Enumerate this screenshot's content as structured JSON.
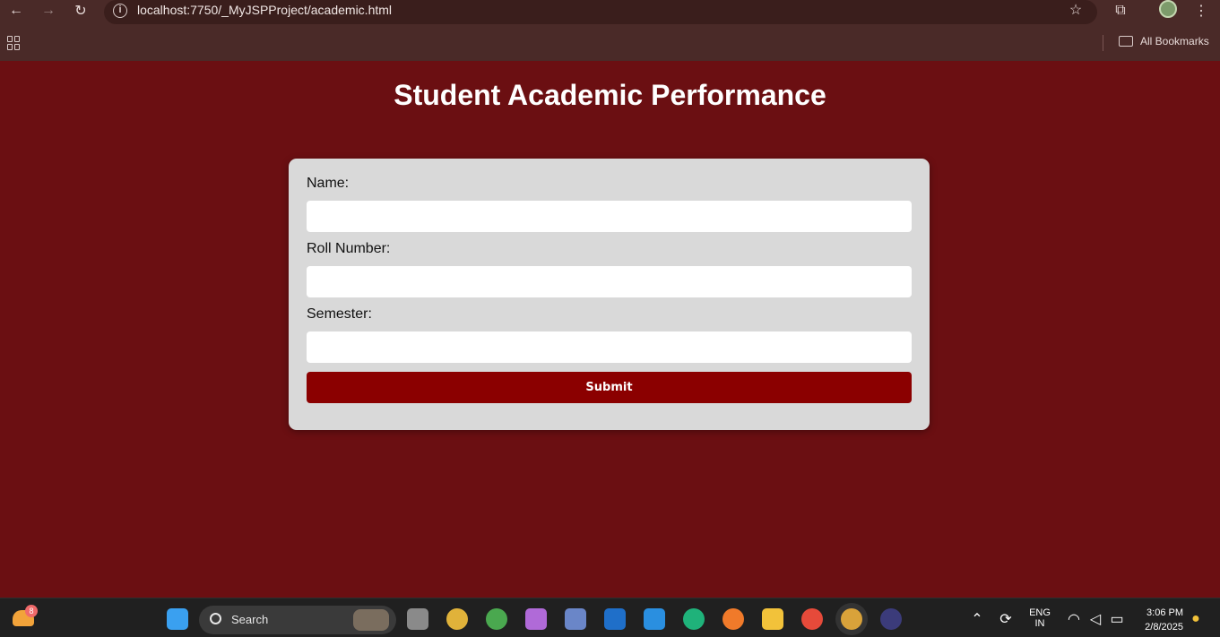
{
  "browser": {
    "url": "localhost:7750/_MyJSPProject/academic.html",
    "bookmarks_label": "All Bookmarks"
  },
  "page": {
    "title": "Student Academic Performance",
    "form": {
      "name_label": "Name:",
      "name_value": "",
      "roll_label": "Roll Number:",
      "roll_value": "",
      "semester_label": "Semester:",
      "semester_value": "",
      "submit_label": "Submit"
    }
  },
  "taskbar": {
    "weather_badge": "8",
    "search_label": "Search",
    "language": "ENG",
    "region": "IN",
    "time": "3:06 PM",
    "date": "2/8/2025"
  },
  "colors": {
    "page_background": "#6b0f12",
    "card_background": "#d9d9d9",
    "submit_background": "#8b0000"
  }
}
